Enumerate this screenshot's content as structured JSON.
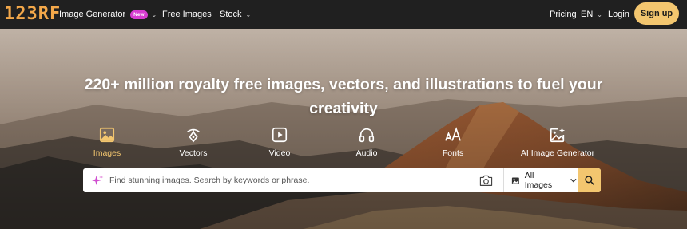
{
  "brand": {
    "logo_text": "123RF",
    "accent": "#f3c66f",
    "logo_color": "#f3a84a"
  },
  "nav": {
    "image_generator": "Image Generator",
    "new_badge": "New",
    "free_images": "Free Images",
    "stock": "Stock",
    "pricing": "Pricing",
    "language": "EN",
    "login": "Login",
    "signup": "Sign up"
  },
  "hero": {
    "title": "220+ million royalty free images, vectors, and illustrations to fuel your creativity"
  },
  "categories": [
    {
      "label": "Images",
      "icon": "image-icon",
      "active": true
    },
    {
      "label": "Vectors",
      "icon": "pen-nib-icon",
      "active": false
    },
    {
      "label": "Video",
      "icon": "play-icon",
      "active": false
    },
    {
      "label": "Audio",
      "icon": "headphones-icon",
      "active": false
    },
    {
      "label": "Fonts",
      "icon": "font-icon",
      "active": false
    },
    {
      "label": "AI Image Generator",
      "icon": "ai-image-icon",
      "active": false
    }
  ],
  "search": {
    "placeholder": "Find stunning images. Search by keywords or phrase.",
    "type_selected": "All Images"
  }
}
